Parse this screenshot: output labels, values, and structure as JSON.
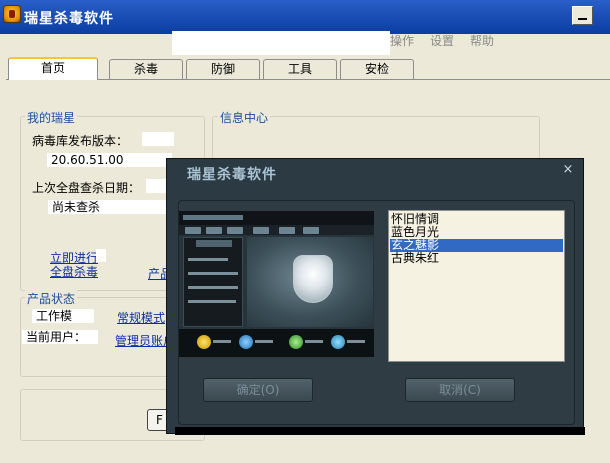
{
  "window": {
    "title": "瑞星杀毒软件"
  },
  "top_menu": [
    "操作",
    "设置",
    "帮助"
  ],
  "tabs": [
    {
      "label": "首页",
      "active": true
    },
    {
      "label": "杀毒",
      "active": false
    },
    {
      "label": "防御",
      "active": false
    },
    {
      "label": "工具",
      "active": false
    },
    {
      "label": "安检",
      "active": false
    }
  ],
  "my_rising": {
    "title": "我的瑞星",
    "virus_db_label": "病毒库发布版本：",
    "virus_db_version": "20.60.51.00",
    "last_scan_label": "上次全盘查杀日期：",
    "last_scan_value": "尚未查杀",
    "scan_now_link_1": "立即进行",
    "scan_now_link_2": "全盘杀毒",
    "product_link": "产品"
  },
  "info_center": {
    "title": "信息中心"
  },
  "product_status": {
    "title": "产品状态",
    "work_mode_label": "工作模",
    "work_mode_value": "常规模式",
    "current_user_label": "当前用户：",
    "current_user_value": "管理员账户"
  },
  "ok_stub_label": "F",
  "skin_dialog": {
    "title": "瑞星杀毒软件",
    "close": "×",
    "skins": [
      "怀旧情调",
      "蓝色月光",
      "玄之魅影",
      "古典朱红"
    ],
    "selected_index": 2,
    "confirm_label": "确定(O)",
    "cancel_label": "取消(C)"
  },
  "colors": {
    "titlebar": "#0a3ea0",
    "dialog_bg": "#2c3b43",
    "selection": "#316ac5",
    "group_title": "#1c4ea2",
    "active_tab_accent": "#ffc03a"
  }
}
